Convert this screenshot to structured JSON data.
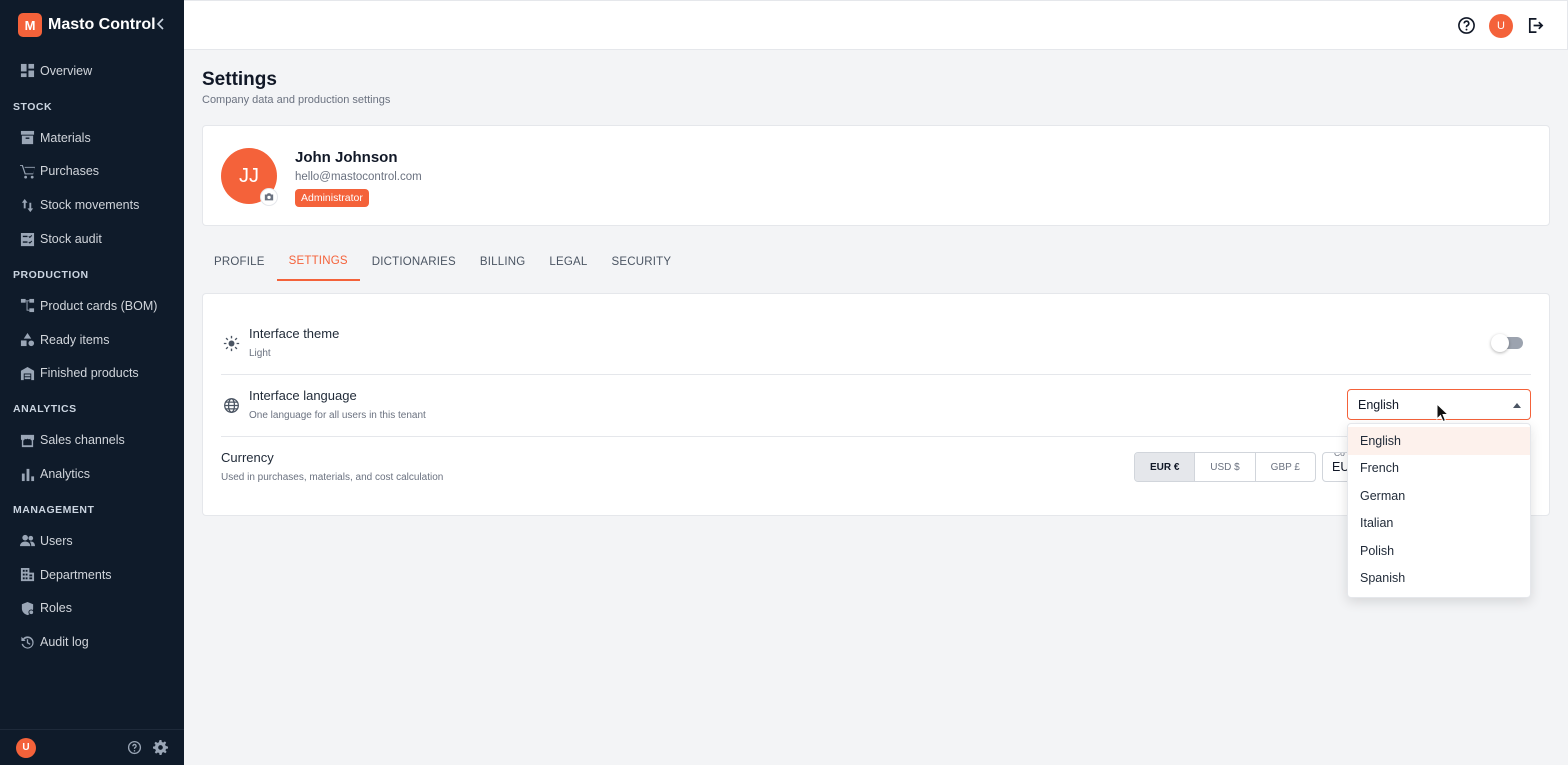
{
  "app": {
    "logo_letter": "M",
    "name": "Masto Control",
    "collapse_icon": "chevron-left-icon",
    "accent_color": "#f4623a"
  },
  "sidebar": {
    "overview": {
      "label": "Overview",
      "icon": "dashboard-icon"
    },
    "sections": [
      {
        "title": "STOCK",
        "items": [
          {
            "label": "Materials",
            "icon": "archive-icon"
          },
          {
            "label": "Purchases",
            "icon": "cart-icon"
          },
          {
            "label": "Stock movements",
            "icon": "arrows-updown-icon"
          },
          {
            "label": "Stock audit",
            "icon": "checklist-icon"
          }
        ]
      },
      {
        "title": "PRODUCTION",
        "items": [
          {
            "label": "Product cards (BOM)",
            "icon": "tree-icon"
          },
          {
            "label": "Ready items",
            "icon": "shapes-icon"
          },
          {
            "label": "Finished products",
            "icon": "warehouse-icon"
          }
        ]
      },
      {
        "title": "ANALYTICS",
        "items": [
          {
            "label": "Sales channels",
            "icon": "store-icon"
          },
          {
            "label": "Analytics",
            "icon": "bar-chart-icon"
          }
        ]
      },
      {
        "title": "MANAGEMENT",
        "items": [
          {
            "label": "Users",
            "icon": "users-icon"
          },
          {
            "label": "Departments",
            "icon": "building-icon"
          },
          {
            "label": "Roles",
            "icon": "shield-icon"
          },
          {
            "label": "Audit log",
            "icon": "history-icon"
          }
        ]
      }
    ],
    "footer": {
      "avatar_letter": "U",
      "help_icon": "help-circle-icon",
      "settings_icon": "gear-icon"
    }
  },
  "topbar": {
    "help_icon": "help-circle-icon",
    "avatar_letter": "U",
    "logout_icon": "logout-icon"
  },
  "page": {
    "title": "Settings",
    "subtitle": "Company data and production settings"
  },
  "profile": {
    "initials": "JJ",
    "name": "John Johnson",
    "email": "hello@mastocontrol.com",
    "role": "Administrator",
    "camera_icon": "camera-icon"
  },
  "tabs": [
    {
      "label": "PROFILE",
      "active": false
    },
    {
      "label": "SETTINGS",
      "active": true
    },
    {
      "label": "DICTIONARIES",
      "active": false
    },
    {
      "label": "BILLING",
      "active": false
    },
    {
      "label": "LEGAL",
      "active": false
    },
    {
      "label": "SECURITY",
      "active": false
    }
  ],
  "settings": {
    "theme": {
      "title": "Interface theme",
      "value": "Light",
      "icon": "sun-icon",
      "dark_mode_enabled": false
    },
    "language": {
      "title": "Interface language",
      "description": "One language for all users in this tenant",
      "icon": "globe-icon",
      "selected": "English",
      "options": [
        "English",
        "French",
        "German",
        "Italian",
        "Polish",
        "Spanish"
      ]
    },
    "currency": {
      "title": "Currency",
      "description": "Used in purchases, materials, and cost calculation",
      "options": [
        "EUR €",
        "USD $",
        "GBP £"
      ],
      "selected": "EUR €",
      "code_label": "Co",
      "code_value": "EU"
    }
  }
}
